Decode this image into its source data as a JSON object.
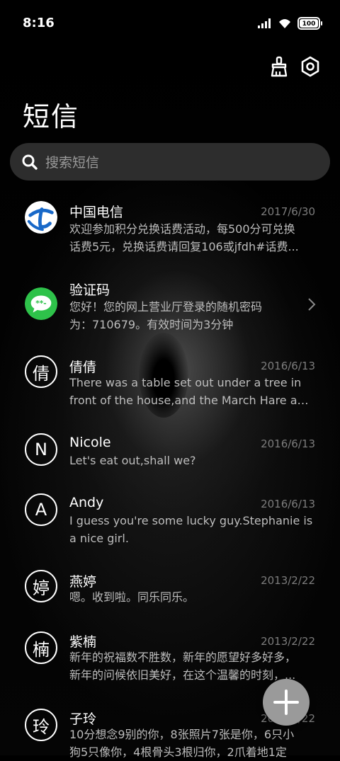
{
  "status_bar": {
    "time": "8:16",
    "battery": "100"
  },
  "header": {
    "title": "短信"
  },
  "search": {
    "placeholder": "搜索短信"
  },
  "conversations": [
    {
      "name": "中国电信",
      "date": "2017/6/30",
      "preview": [
        "欢迎参加积分兑换话费活动，每500分可兑换",
        "话费5元，兑换话费请回复106或jfdh#话费..."
      ],
      "avatar": "china-telecom-logo"
    },
    {
      "name": "验证码",
      "date": "",
      "preview": [
        "您好！您的网上营业厅登录的随机密码",
        "为：710679。有效时间为3分钟"
      ],
      "avatar": "message-bubble-icon"
    },
    {
      "name": "倩倩",
      "date": "2016/6/13",
      "avatar_text": "倩",
      "preview": [
        "There was a table set out under a tree in",
        "front of the house,and the March Hare an..."
      ]
    },
    {
      "name": "Nicole",
      "date": "2016/6/13",
      "avatar_text": "N",
      "preview": [
        "Let's eat out,shall we?"
      ]
    },
    {
      "name": "Andy",
      "date": "2016/6/13",
      "avatar_text": "A",
      "preview": [
        "I guess you're some lucky guy.Stephanie is",
        "a nice girl."
      ]
    },
    {
      "name": "燕婷",
      "date": "2013/2/22",
      "avatar_text": "婷",
      "preview": [
        "嗯。收到啦。同乐同乐。"
      ]
    },
    {
      "name": "紫楠",
      "date": "2013/2/22",
      "avatar_text": "楠",
      "preview": [
        "新年的祝福数不胜数，新年的愿望好多好多，",
        "新年的问候依旧美好，在这个温馨的时刻，..."
      ]
    },
    {
      "name": "子玲",
      "date": "2013/2/22",
      "avatar_text": "玲",
      "preview": [
        "10分想念9别的你，8张照片7张是你，6只小",
        "狗5只像你，4根骨头3根归你，2爪着地1定"
      ]
    }
  ],
  "colors": {
    "telecom_blue": "#1868c8",
    "wechat_green": "#2ec24a",
    "fab": "#9a9a9a"
  }
}
